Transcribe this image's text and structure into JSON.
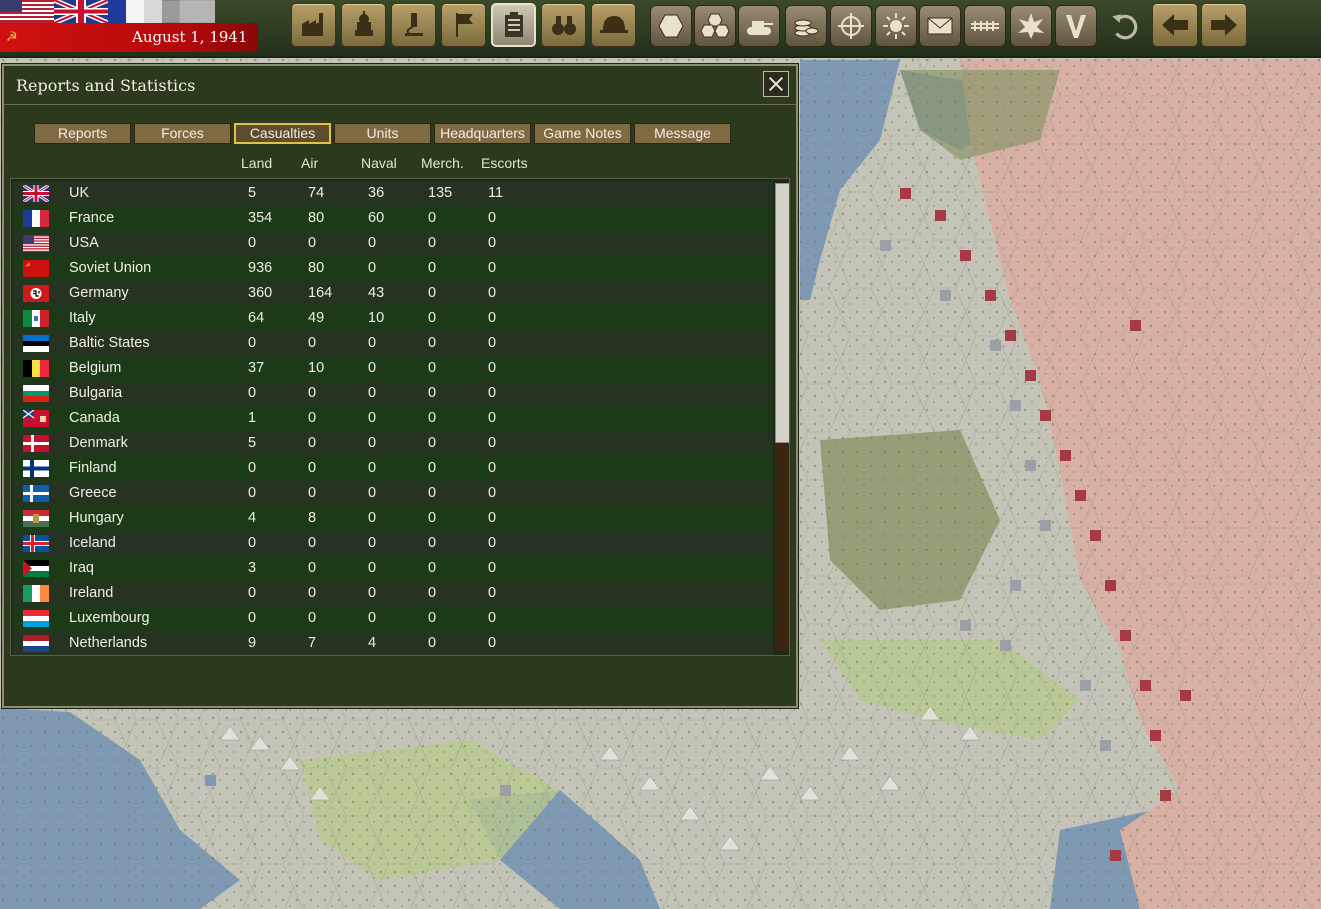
{
  "topbar": {
    "date": "August 1, 1941",
    "nations_flags": [
      "usa-flag",
      "uk-flag",
      "france-flag"
    ],
    "buttons": [
      {
        "name": "production-button",
        "icon": "factory-icon"
      },
      {
        "name": "diplomacy-button",
        "icon": "capitol-icon"
      },
      {
        "name": "research-button",
        "icon": "microscope-icon"
      },
      {
        "name": "decisions-button",
        "icon": "flag-icon"
      },
      {
        "name": "reports-button",
        "icon": "clipboard-icon",
        "selected": true
      },
      {
        "name": "intelligence-button",
        "icon": "binoculars-icon"
      },
      {
        "name": "units-button",
        "icon": "helmet-icon"
      },
      {
        "name": "hex-mode-button",
        "icon": "hex-icon"
      },
      {
        "name": "hex-grid-button",
        "icon": "hex-grid-icon"
      },
      {
        "name": "tank-button",
        "icon": "tank-icon"
      },
      {
        "name": "supply-button",
        "icon": "coins-icon"
      },
      {
        "name": "target-button",
        "icon": "crosshair-icon"
      },
      {
        "name": "weather-button",
        "icon": "sun-icon"
      },
      {
        "name": "mail-button",
        "icon": "envelope-icon"
      },
      {
        "name": "railroad-button",
        "icon": "railroad-icon"
      },
      {
        "name": "combat-button",
        "icon": "explosion-icon"
      },
      {
        "name": "victory-button",
        "icon": "v-icon"
      },
      {
        "name": "undo-button",
        "icon": "undo-icon"
      },
      {
        "name": "previous-button",
        "icon": "arrow-left-icon"
      },
      {
        "name": "next-button",
        "icon": "arrow-right-icon"
      }
    ]
  },
  "dialog": {
    "title": "Reports and Statistics",
    "tabs": [
      "Reports",
      "Forces",
      "Casualties",
      "Units",
      "Headquarters",
      "Game Notes",
      "Message"
    ],
    "active_tab": "Casualties",
    "columns": [
      "Land",
      "Air",
      "Naval",
      "Merch.",
      "Escorts"
    ],
    "rows": [
      {
        "country": "UK",
        "land": "5",
        "air": "74",
        "naval": "36",
        "merch": "135",
        "escorts": "11",
        "flag": "uk"
      },
      {
        "country": "France",
        "land": "354",
        "air": "80",
        "naval": "60",
        "merch": "0",
        "escorts": "0",
        "flag": "france"
      },
      {
        "country": "USA",
        "land": "0",
        "air": "0",
        "naval": "0",
        "merch": "0",
        "escorts": "0",
        "flag": "usa"
      },
      {
        "country": "Soviet Union",
        "land": "936",
        "air": "80",
        "naval": "0",
        "merch": "0",
        "escorts": "0",
        "flag": "soviet"
      },
      {
        "country": "Germany",
        "land": "360",
        "air": "164",
        "naval": "43",
        "merch": "0",
        "escorts": "0",
        "flag": "germany"
      },
      {
        "country": "Italy",
        "land": "64",
        "air": "49",
        "naval": "10",
        "merch": "0",
        "escorts": "0",
        "flag": "italy"
      },
      {
        "country": "Baltic States",
        "land": "0",
        "air": "0",
        "naval": "0",
        "merch": "0",
        "escorts": "0",
        "flag": "baltic"
      },
      {
        "country": "Belgium",
        "land": "37",
        "air": "10",
        "naval": "0",
        "merch": "0",
        "escorts": "0",
        "flag": "belgium"
      },
      {
        "country": "Bulgaria",
        "land": "0",
        "air": "0",
        "naval": "0",
        "merch": "0",
        "escorts": "0",
        "flag": "bulgaria"
      },
      {
        "country": "Canada",
        "land": "1",
        "air": "0",
        "naval": "0",
        "merch": "0",
        "escorts": "0",
        "flag": "canada"
      },
      {
        "country": "Denmark",
        "land": "5",
        "air": "0",
        "naval": "0",
        "merch": "0",
        "escorts": "0",
        "flag": "denmark"
      },
      {
        "country": "Finland",
        "land": "0",
        "air": "0",
        "naval": "0",
        "merch": "0",
        "escorts": "0",
        "flag": "finland"
      },
      {
        "country": "Greece",
        "land": "0",
        "air": "0",
        "naval": "0",
        "merch": "0",
        "escorts": "0",
        "flag": "greece"
      },
      {
        "country": "Hungary",
        "land": "4",
        "air": "8",
        "naval": "0",
        "merch": "0",
        "escorts": "0",
        "flag": "hungary"
      },
      {
        "country": "Iceland",
        "land": "0",
        "air": "0",
        "naval": "0",
        "merch": "0",
        "escorts": "0",
        "flag": "iceland"
      },
      {
        "country": "Iraq",
        "land": "3",
        "air": "0",
        "naval": "0",
        "merch": "0",
        "escorts": "0",
        "flag": "iraq"
      },
      {
        "country": "Ireland",
        "land": "0",
        "air": "0",
        "naval": "0",
        "merch": "0",
        "escorts": "0",
        "flag": "ireland"
      },
      {
        "country": "Luxembourg",
        "land": "0",
        "air": "0",
        "naval": "0",
        "merch": "0",
        "escorts": "0",
        "flag": "luxembourg"
      },
      {
        "country": "Netherlands",
        "land": "9",
        "air": "7",
        "naval": "4",
        "merch": "0",
        "escorts": "0",
        "flag": "netherlands"
      }
    ]
  },
  "colors": {
    "allied_territory": "#d8b1a4",
    "axis_territory": "#c7c8bb",
    "sea": "#7f9ab5",
    "axis_units": "#9aa0a6",
    "soviet_units": "#a53a44"
  }
}
